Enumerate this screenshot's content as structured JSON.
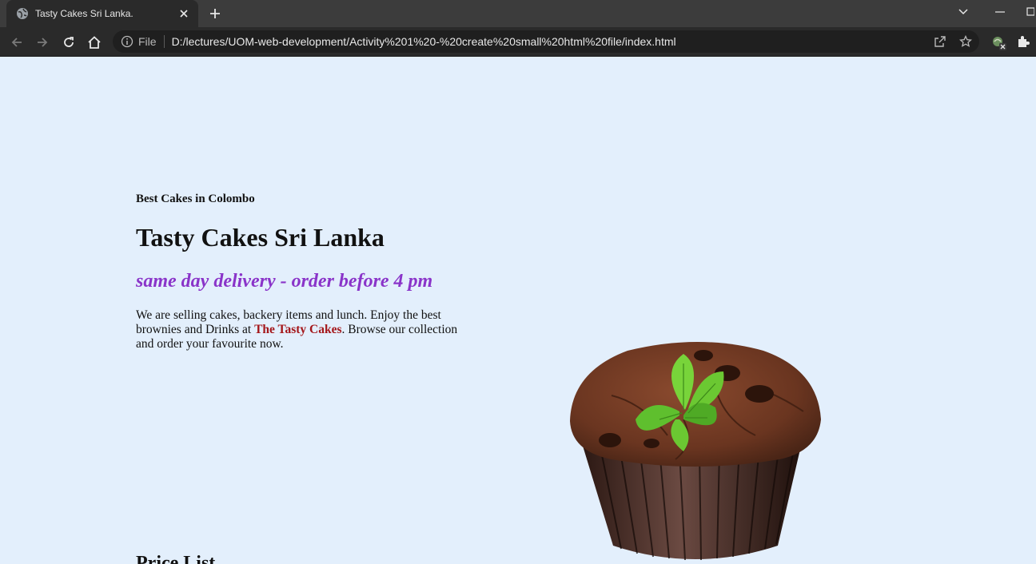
{
  "browser": {
    "tab_title": "Tasty Cakes Sri Lanka.",
    "scheme_label": "File",
    "url": "D:/lectures/UOM-web-development/Activity%201%20-%20create%20small%20html%20file/index.html"
  },
  "page": {
    "kicker": "Best Cakes in Colombo",
    "headline": "Tasty Cakes Sri Lanka",
    "tagline": "same day delivery - order before 4 pm",
    "intro_before": "We are selling cakes, backery items and lunch. Enjoy the best brownies and Drinks at ",
    "intro_brand": "The Tasty Cakes",
    "intro_after": ". Browse our collection and order your favourite now.",
    "price_list_heading": "Price List"
  },
  "icons": {
    "tab": "globe-icon",
    "close": "close-icon",
    "new_tab": "plus-icon",
    "back": "back-arrow-icon",
    "forward": "forward-arrow-icon",
    "reload": "reload-icon",
    "home": "home-icon",
    "info": "info-icon",
    "share": "share-icon",
    "bookmark": "star-icon",
    "extension": "puzzle-icon"
  },
  "colors": {
    "page_background": "#e3effc",
    "tagline": "#8a34c9",
    "brand": "#a4161a"
  }
}
